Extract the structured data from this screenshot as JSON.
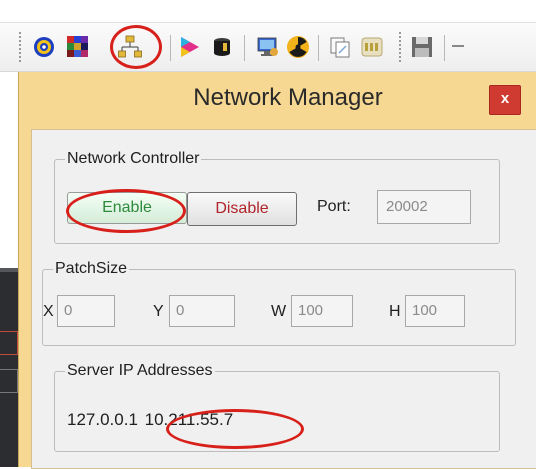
{
  "toolbar": {
    "icons": [
      "target-icon",
      "color-grid-icon",
      "network-icon",
      "play-triangle-icon",
      "drum-icon",
      "monitor-sync-icon",
      "radiation-icon",
      "copy-icon",
      "settings-badge-icon",
      "save-icon"
    ]
  },
  "window": {
    "title": "Network Manager",
    "close_label": "x",
    "accent_color": "#f6d892"
  },
  "network_controller": {
    "legend": "Network Controller",
    "enable_label": "Enable",
    "disable_label": "Disable",
    "port_label": "Port:",
    "port_value": "20002"
  },
  "patch_size": {
    "legend": "PatchSize",
    "x_label": "X",
    "x_value": "0",
    "y_label": "Y",
    "y_value": "0",
    "w_label": "W",
    "w_value": "100",
    "h_label": "H",
    "h_value": "100"
  },
  "server_ips": {
    "legend": "Server IP Addresses",
    "addresses": [
      "127.0.0.1",
      "10.211.55.7"
    ]
  }
}
